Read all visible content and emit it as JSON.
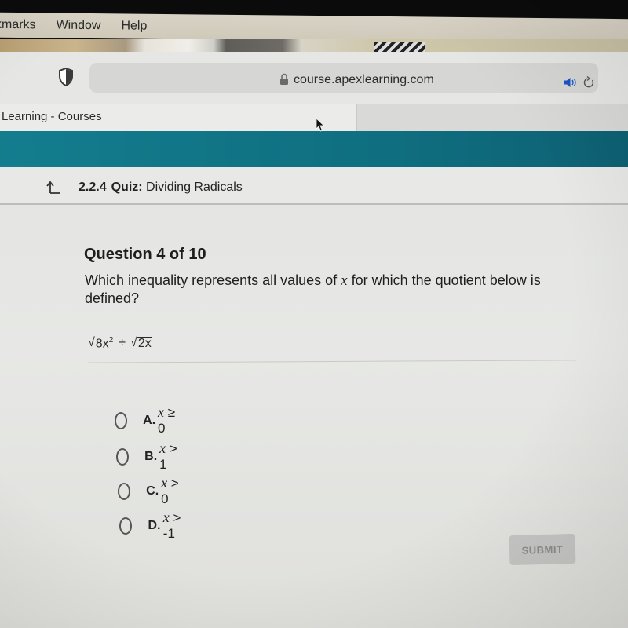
{
  "menubar": {
    "items": [
      "kmarks",
      "Window",
      "Help"
    ]
  },
  "browser": {
    "url": "course.apexlearning.com",
    "tab_title": "Learning - Courses",
    "icons": {
      "shield": "shield-icon",
      "lock": "lock-icon",
      "speaker": "speaker-icon",
      "reload": "reload-icon"
    },
    "colors": {
      "speaker": "#1a56c9"
    }
  },
  "header": {
    "color": "#137d8e"
  },
  "breadcrumb": {
    "number": "2.2.4",
    "kind": "Quiz:",
    "title": "Dividing Radicals",
    "icon": "up-arrow-icon"
  },
  "question": {
    "title": "Question 4 of 10",
    "text_before": "Which inequality represents all values of ",
    "variable": "x",
    "text_after": " for which the quotient below is defined?",
    "expression": {
      "radicand1": "8x",
      "exponent1": "2",
      "operator": "÷",
      "radicand2": "2x"
    }
  },
  "options": [
    {
      "letter": "A.",
      "var": "x",
      "rel": " ≥ 0"
    },
    {
      "letter": "B.",
      "var": "x",
      "rel": " > 1"
    },
    {
      "letter": "C.",
      "var": "x",
      "rel": " > 0"
    },
    {
      "letter": "D.",
      "var": "x",
      "rel": " > -1"
    }
  ],
  "submit_label": "SUBMIT"
}
